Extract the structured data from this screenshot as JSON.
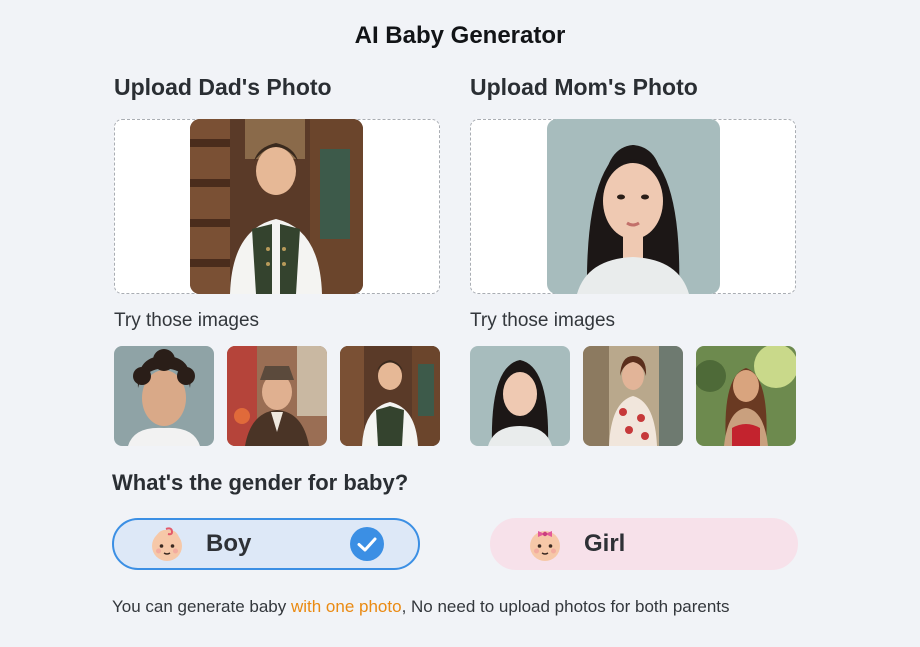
{
  "page": {
    "title": "AI Baby Generator"
  },
  "dad": {
    "heading": "Upload Dad's Photo",
    "try_label": "Try those images"
  },
  "mom": {
    "heading": "Upload Mom's Photo",
    "try_label": "Try those images"
  },
  "gender": {
    "question": "What's the gender for baby?",
    "options": [
      {
        "label": "Boy",
        "selected": true
      },
      {
        "label": "Girl",
        "selected": false
      }
    ]
  },
  "note": {
    "before": "You can generate baby ",
    "highlight": "with one photo",
    "after": ", No need to upload photos for both parents"
  },
  "colors": {
    "accent": "#3b8fe4",
    "highlight": "#ea8a12",
    "boy_bg": "#dde8f7",
    "girl_bg": "#f7e1ea"
  }
}
